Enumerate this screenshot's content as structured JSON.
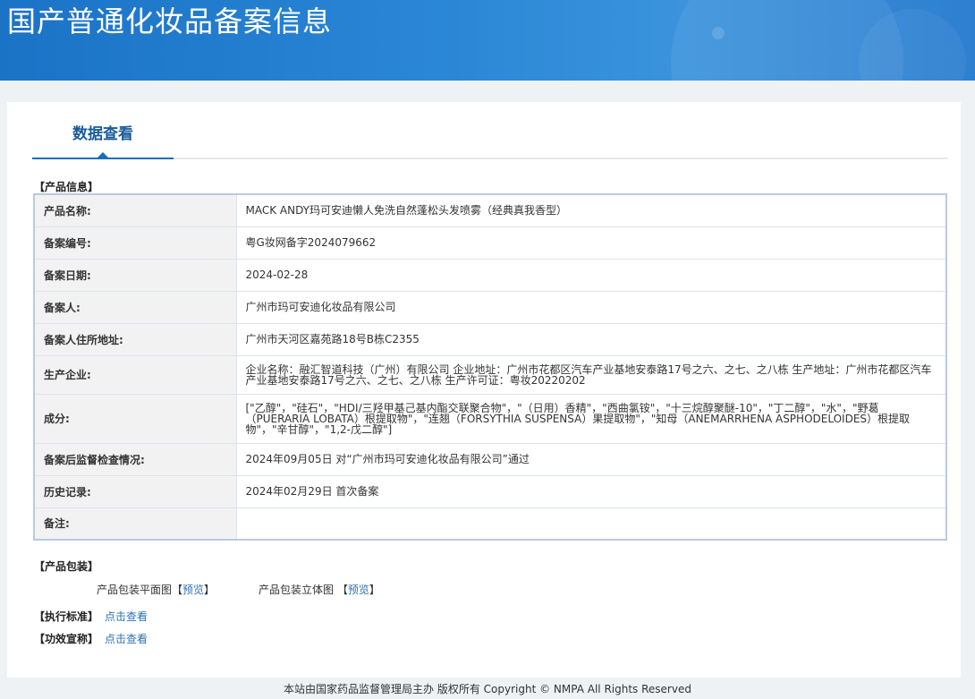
{
  "header": {
    "title": "国产普通化妆品备案信息"
  },
  "tabs": [
    {
      "label": "数据查看",
      "active": true
    }
  ],
  "product_info": {
    "section_label": "【产品信息】",
    "rows": [
      {
        "label": "产品名称:",
        "value": "MACK ANDY玛可安迪懒人免洗自然蓬松头发喷雾（经典真我香型）"
      },
      {
        "label": "备案编号:",
        "value": "粤G妆网备字2024079662"
      },
      {
        "label": "备案日期:",
        "value": "2024-02-28"
      },
      {
        "label": "备案人:",
        "value": "广州市玛可安迪化妆品有限公司"
      },
      {
        "label": "备案人住所地址:",
        "value": "广州市天河区嘉苑路18号B栋C2355"
      },
      {
        "label": "生产企业:",
        "value": "企业名称：融汇智道科技（广州）有限公司 企业地址：广州市花都区汽车产业基地安泰路17号之六、之七、之八栋 生产地址：广州市花都区汽车产业基地安泰路17号之六、之七、之八栋 生产许可证：粤妆20220202"
      },
      {
        "label": "成分:",
        "value": "[\"乙醇\"，\"硅石\"，\"HDI/三羟甲基己基内酯交联聚合物\"，\"（日用）香精\"，\"西曲氯铵\"，\"十三烷醇聚醚-10\"，\"丁二醇\"，\"水\"，\"野葛（PUERARIA LOBATA）根提取物\"，\"连翘（FORSYTHIA SUSPENSA）果提取物\"，\"知母（ANEMARRHENA ASPHODELOIDES）根提取物\"，\"辛甘醇\"，\"1,2-戊二醇\"]"
      },
      {
        "label": "备案后监督检查情况:",
        "value": "2024年09月05日 对“广州市玛可安迪化妆品有限公司”通过"
      },
      {
        "label": "历史记录:",
        "value": "2024年02月29日 首次备案"
      },
      {
        "label": "备注:",
        "value": ""
      }
    ]
  },
  "packaging": {
    "section_label": "【产品包装】",
    "flat_label": "产品包装平面图",
    "flat_link": "预览",
    "stereo_label": "产品包装立体图",
    "stereo_link": "预览",
    "bracket_open": "【",
    "bracket_close": "】"
  },
  "standard": {
    "section_label": "【执行标准】",
    "link": "点击查看"
  },
  "efficacy": {
    "section_label": "【功效宣称】",
    "link": "点击查看"
  },
  "footer": {
    "text": "本站由国家药品监督管理局主办 版权所有 Copyright © NMPA All Rights Reserved"
  }
}
